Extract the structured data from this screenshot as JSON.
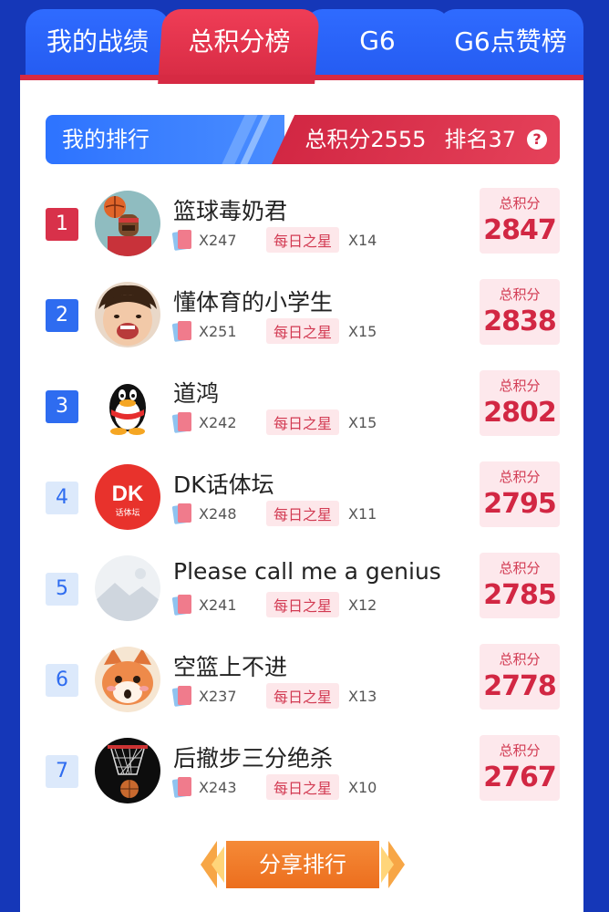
{
  "tabs": [
    {
      "label": "我的战绩"
    },
    {
      "label": "总积分榜"
    },
    {
      "label": "G6"
    },
    {
      "label": "G6点赞榜"
    }
  ],
  "my_rank": {
    "label": "我的排行",
    "total_points": "总积分2555",
    "rank": "排名37",
    "help_icon": "?"
  },
  "score_label": "总积分",
  "star_tag": "每日之星",
  "entries": [
    {
      "rank": "1",
      "name": "篮球毒奶君",
      "cards": "X247",
      "stars": "X14",
      "score": "2847"
    },
    {
      "rank": "2",
      "name": "懂体育的小学生",
      "cards": "X251",
      "stars": "X15",
      "score": "2838"
    },
    {
      "rank": "3",
      "name": "道鸿",
      "cards": "X242",
      "stars": "X15",
      "score": "2802"
    },
    {
      "rank": "4",
      "name": "DK话体坛",
      "cards": "X248",
      "stars": "X11",
      "score": "2795",
      "avatar_text": "DK",
      "avatar_sub": "话体坛"
    },
    {
      "rank": "5",
      "name": "Please call me a genius",
      "cards": "X241",
      "stars": "X12",
      "score": "2785"
    },
    {
      "rank": "6",
      "name": "空篮上不进",
      "cards": "X237",
      "stars": "X13",
      "score": "2778"
    },
    {
      "rank": "7",
      "name": "后撤步三分绝杀",
      "cards": "X243",
      "stars": "X10",
      "score": "2767"
    }
  ],
  "share_button": "分享排行",
  "colors": {
    "background": "#1537b8",
    "accent_red": "#d22743",
    "accent_blue": "#2e6cf0",
    "share_orange": "#ec6e1e"
  }
}
